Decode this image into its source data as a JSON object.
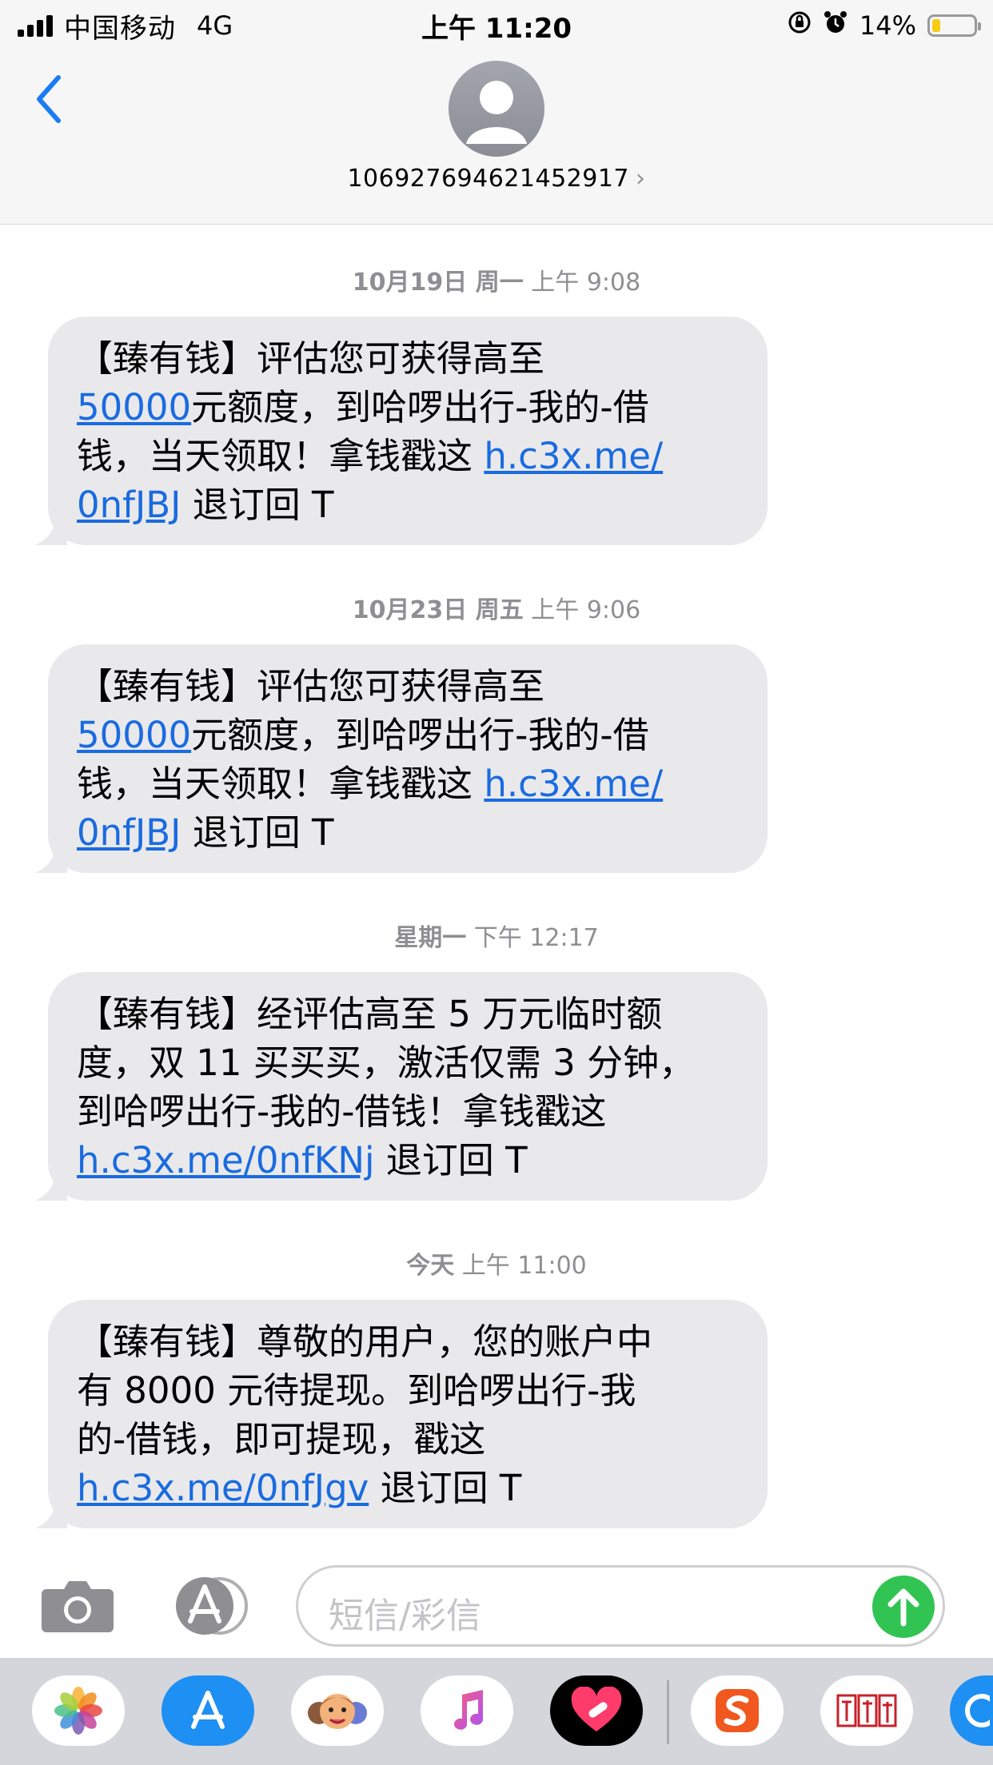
{
  "status_bar": {
    "carrier": "中国移动",
    "network": "4G",
    "time": "上午 11:20",
    "battery_percent": "14%",
    "battery_level": 0.14,
    "battery_color": "#f6cc15"
  },
  "header": {
    "contact_number": "106927694621452917",
    "back_icon": "chevron-left-icon",
    "chevron": "›"
  },
  "messages": [
    {
      "timestamp_date": "10月19日 周一",
      "timestamp_time": "上午 9:08",
      "lines": [
        "【臻有钱】评估您可获得高至",
        "元额度，到哈啰出行-我的-借",
        "钱，当天领取！拿钱戳这 ",
        "退订回 T"
      ],
      "amount_link": "50000",
      "url_part1": "h.c3x.me/",
      "url_part2": "0nfJBJ"
    },
    {
      "timestamp_date": "10月23日 周五",
      "timestamp_time": "上午 9:06",
      "lines": [
        "【臻有钱】评估您可获得高至",
        "元额度，到哈啰出行-我的-借",
        "钱，当天领取！拿钱戳这 ",
        "退订回 T"
      ],
      "amount_link": "50000",
      "url_part1": "h.c3x.me/",
      "url_part2": "0nfJBJ"
    },
    {
      "timestamp_date": "星期一",
      "timestamp_time": "下午 12:17",
      "lines": [
        "【臻有钱】经评估高至 5 万元临时额",
        "度，双 11 买买买，激活仅需 3 分钟，",
        "到哈啰出行-我的-借钱！拿钱戳这",
        "退订回 T"
      ],
      "url": "h.c3x.me/0nfKNj"
    },
    {
      "timestamp_date": "今天",
      "timestamp_time": "上午 11:00",
      "lines": [
        "【臻有钱】尊敬的用户，您的账户中",
        "有 8000 元待提现。到哈啰出行-我",
        "的-借钱，即可提现，戳这",
        "退订回 T"
      ],
      "url": "h.c3x.me/0nfJgv"
    }
  ],
  "input_bar": {
    "placeholder": "短信/彩信",
    "camera_icon": "camera-icon",
    "apps_icon": "app-store-icon",
    "send_icon": "arrow-up-icon",
    "send_color": "#31c452"
  },
  "dock": {
    "apps": [
      "photos-icon",
      "app-store-icon",
      "memoji-icon",
      "music-icon",
      "heart-app-icon",
      "sogou-icon",
      "seal-app-icon",
      "partial-app-icon"
    ]
  },
  "colors": {
    "link": "#1a6be0",
    "bubble": "#e9e9eb",
    "timestamp": "#8e8e93"
  }
}
